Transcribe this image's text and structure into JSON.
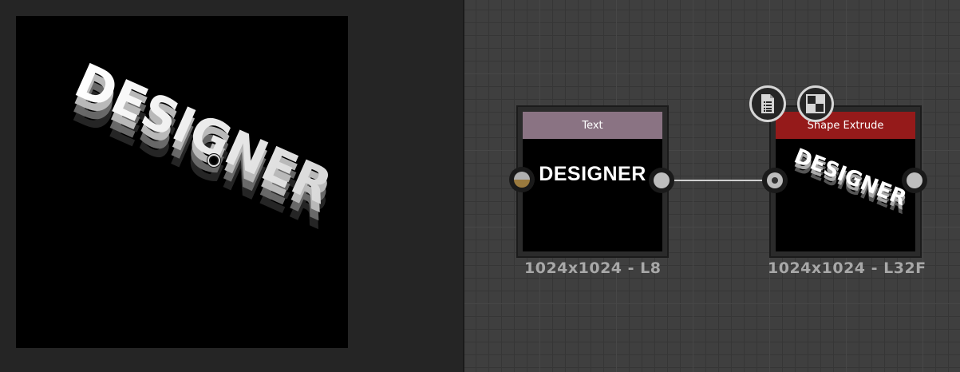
{
  "viewport": {
    "text": "DESIGNER"
  },
  "graph": {
    "nodes": [
      {
        "id": "text",
        "title": "Text",
        "header_color": "#8a7383",
        "preview_text": "DESIGNER",
        "resolution": "1024x1024 - L8",
        "input_port_color": "#9a7a3e"
      },
      {
        "id": "shape-extrude",
        "title": "Shape Extrude",
        "header_color": "#951a1a",
        "resolution": "1024x1024 - L32F",
        "preview_text": "DESIGNER"
      }
    ],
    "toolbar": {
      "icons": [
        "document-list-icon",
        "checker-icon"
      ]
    }
  }
}
